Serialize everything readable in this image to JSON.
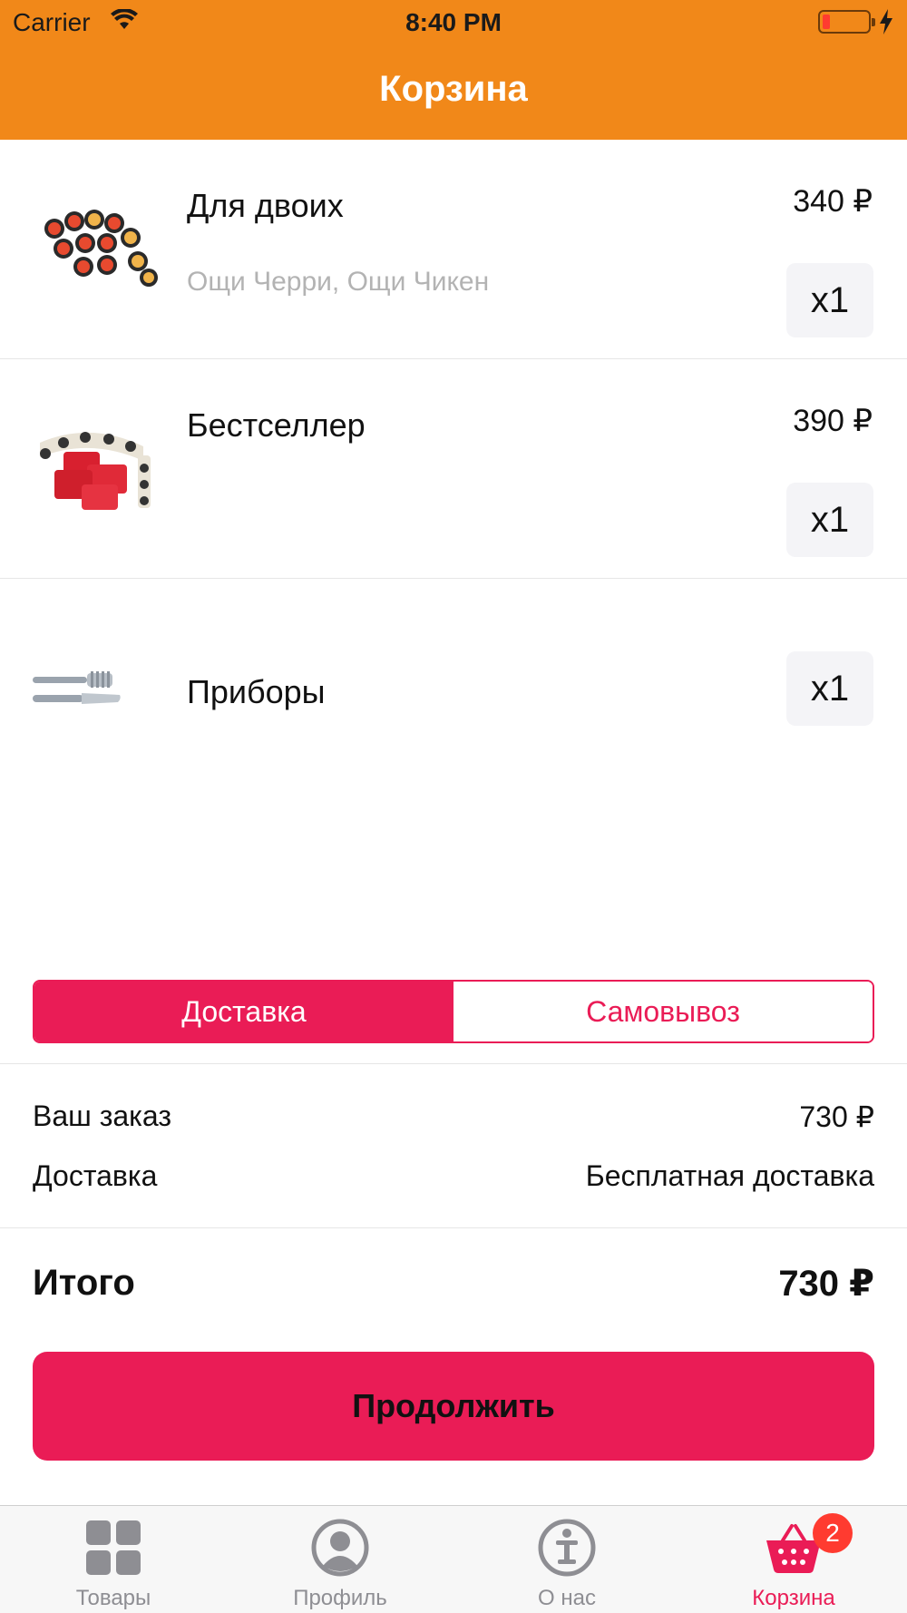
{
  "status_bar": {
    "carrier": "Carrier",
    "time": "8:40 PM"
  },
  "nav": {
    "title": "Корзина"
  },
  "cart_items": [
    {
      "name": "Для двоих",
      "description": "Ощи Черри, Ощи Чикен",
      "price": "340 ₽",
      "quantity": "x1",
      "image": "sushi-set-image"
    },
    {
      "name": "Бестселлер",
      "description": "",
      "price": "390 ₽",
      "quantity": "x1",
      "image": "sushi-roll-image"
    },
    {
      "name": "Приборы",
      "description": "",
      "price": "",
      "quantity": "x1",
      "image": "cutlery-image"
    }
  ],
  "delivery_toggle": {
    "options": [
      "Доставка",
      "Самовывоз"
    ],
    "selected": "Доставка"
  },
  "summary": {
    "order_label": "Ваш заказ",
    "order_value": "730 ₽",
    "delivery_label": "Доставка",
    "delivery_value": "Бесплатная доставка"
  },
  "total": {
    "label": "Итого",
    "value": "730 ₽"
  },
  "continue_button": {
    "label": "Продолжить"
  },
  "tabbar": {
    "tabs": [
      {
        "label": "Товары",
        "icon": "grid-icon"
      },
      {
        "label": "Профиль",
        "icon": "profile-icon"
      },
      {
        "label": "О нас",
        "icon": "info-icon"
      },
      {
        "label": "Корзина",
        "icon": "basket-icon",
        "badge": "2",
        "active": true
      }
    ]
  },
  "colors": {
    "header": "#f18819",
    "accent": "#ea1c56",
    "badge": "#ff3b30"
  }
}
